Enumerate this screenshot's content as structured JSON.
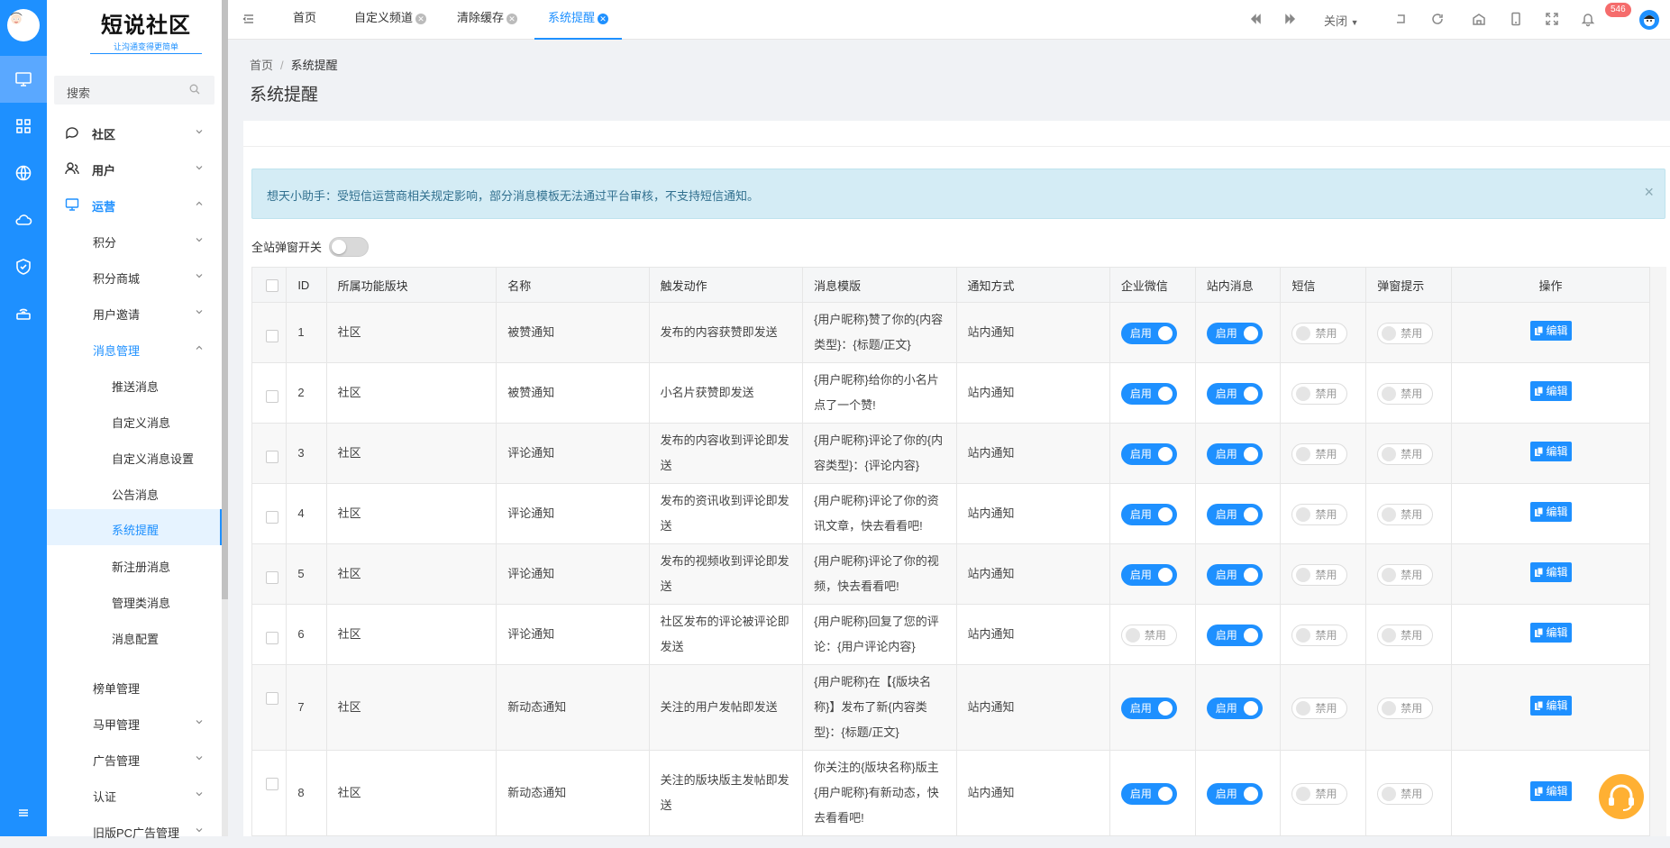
{
  "sidebar": {
    "brand_title": "短说社区",
    "brand_subtitle": "让沟通变得更简单",
    "search_placeholder": "搜索",
    "menu": [
      {
        "label": "社区",
        "level": 1
      },
      {
        "label": "用户",
        "level": 1
      },
      {
        "label": "运营",
        "level": 1
      },
      {
        "label": "积分",
        "level": 2
      },
      {
        "label": "积分商城",
        "level": 2
      },
      {
        "label": "用户邀请",
        "level": 2
      },
      {
        "label": "消息管理",
        "level": 2
      },
      {
        "label": "推送消息",
        "level": 3
      },
      {
        "label": "自定义消息",
        "level": 3
      },
      {
        "label": "自定义消息设置",
        "level": 3
      },
      {
        "label": "公告消息",
        "level": 3
      },
      {
        "label": "系统提醒",
        "level": 3
      },
      {
        "label": "新注册消息",
        "level": 3
      },
      {
        "label": "管理类消息",
        "level": 3
      },
      {
        "label": "消息配置",
        "level": 3
      },
      {
        "label": "榜单管理",
        "level": 2
      },
      {
        "label": "马甲管理",
        "level": 2
      },
      {
        "label": "广告管理",
        "level": 2
      },
      {
        "label": "认证",
        "level": 2
      },
      {
        "label": "旧版PC广告管理",
        "level": 2
      }
    ]
  },
  "topbar": {
    "tabs": [
      "首页",
      "自定义频道",
      "清除缓存",
      "系统提醒"
    ],
    "close_label": "关闭",
    "notification_count": "546"
  },
  "breadcrumb": {
    "home": "首页",
    "current": "系统提醒"
  },
  "page_title": "系统提醒",
  "alert_text": "想天小助手：受短信运营商相关规定影响，部分消息模板无法通过平台审核，不支持短信通知。",
  "alert_close": "×",
  "popup_switch_label": "全站弹窗开关",
  "table": {
    "headers": [
      "ID",
      "所属功能版块",
      "名称",
      "触发动作",
      "消息模版",
      "通知方式",
      "企业微信",
      "站内消息",
      "短信",
      "弹窗提示",
      "操作"
    ],
    "on_label": "启用",
    "off_label": "禁用",
    "edit_label": "编辑",
    "rows": [
      {
        "id": "1",
        "module": "社区",
        "name": "被赞通知",
        "action": "发布的内容获赞即发送",
        "template": "{用户昵称}赞了你的{内容类型}：{标题/正文}",
        "method": "站内通知",
        "wechat": true,
        "site": true,
        "sms": false,
        "popup": false
      },
      {
        "id": "2",
        "module": "社区",
        "name": "被赞通知",
        "action": "小名片获赞即发送",
        "template": "{用户昵称}给你的小名片点了一个赞!",
        "method": "站内通知",
        "wechat": true,
        "site": true,
        "sms": false,
        "popup": false
      },
      {
        "id": "3",
        "module": "社区",
        "name": "评论通知",
        "action": "发布的内容收到评论即发送",
        "template": "{用户昵称}评论了你的{内容类型}：{评论内容}",
        "method": "站内通知",
        "wechat": true,
        "site": true,
        "sms": false,
        "popup": false
      },
      {
        "id": "4",
        "module": "社区",
        "name": "评论通知",
        "action": "发布的资讯收到评论即发送",
        "template": "{用户昵称}评论了你的资讯文章，快去看看吧!",
        "method": "站内通知",
        "wechat": true,
        "site": true,
        "sms": false,
        "popup": false
      },
      {
        "id": "5",
        "module": "社区",
        "name": "评论通知",
        "action": "发布的视频收到评论即发送",
        "template": "{用户昵称}评论了你的视频，快去看看吧!",
        "method": "站内通知",
        "wechat": true,
        "site": true,
        "sms": false,
        "popup": false
      },
      {
        "id": "6",
        "module": "社区",
        "name": "评论通知",
        "action": "社区发布的评论被评论即发送",
        "template": "{用户昵称}回复了您的评论：{用户评论内容}",
        "method": "站内通知",
        "wechat": false,
        "site": true,
        "sms": false,
        "popup": false
      },
      {
        "id": "7",
        "module": "社区",
        "name": "新动态通知",
        "action": "关注的用户发帖即发送",
        "template": "{用户昵称}在【{版块名称}】发布了新{内容类型}：{标题/正文}",
        "method": "站内通知",
        "wechat": true,
        "site": true,
        "sms": false,
        "popup": false
      },
      {
        "id": "8",
        "module": "社区",
        "name": "新动态通知",
        "action": "关注的版块版主发帖即发送",
        "template": "你关注的{版块名称}版主{用户昵称}有新动态，快去看看吧!",
        "method": "站内通知",
        "wechat": true,
        "site": true,
        "sms": false,
        "popup": false
      }
    ]
  },
  "colors": {
    "primary": "#1e90ff",
    "alert_bg": "#d4ecf5",
    "badge": "#f56c6c"
  }
}
